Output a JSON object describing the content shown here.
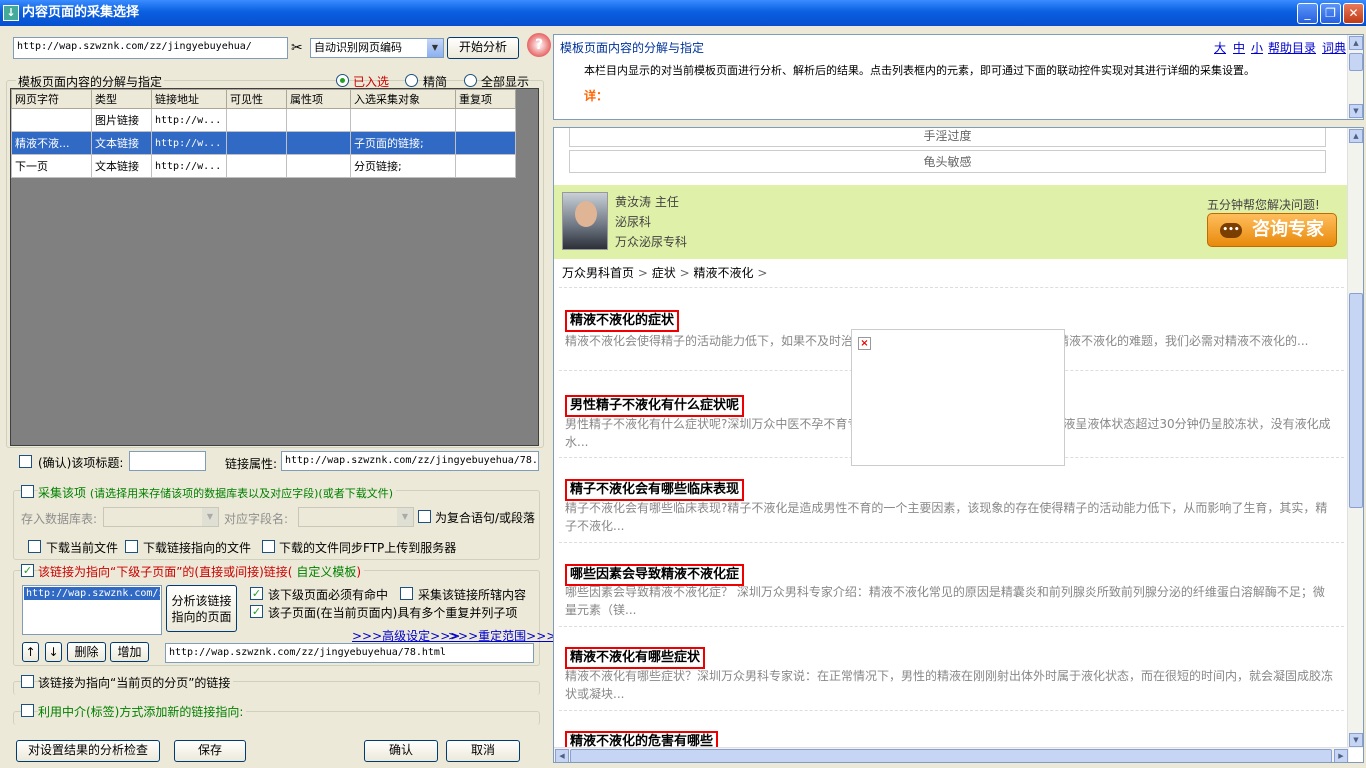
{
  "window": {
    "title": "内容页面的采集选择",
    "min": "_",
    "max": "❐",
    "close": "✕"
  },
  "top": {
    "url": "http://wap.szwznk.com/zz/jingyebuyehua/",
    "encoding": "自动识别网页编码",
    "start_button": "开始分析"
  },
  "group1": {
    "title": "模板页面内容的分解与指定",
    "radios": [
      "已入选",
      "精简",
      "全部显示"
    ]
  },
  "grid": {
    "headers": [
      "网页字符",
      "类型",
      "链接地址",
      "可见性",
      "属性项",
      "入选采集对象",
      "重复项"
    ],
    "rows": [
      [
        "",
        "图片链接",
        "http://w...",
        "",
        "",
        "",
        ""
      ],
      [
        "精液不液...",
        "文本链接",
        "http://w...",
        "",
        "",
        "子页面的链接;",
        ""
      ],
      [
        "下一页",
        "文本链接",
        "http://w...",
        "",
        "",
        "分页链接;",
        ""
      ]
    ]
  },
  "confirm": {
    "label": "(确认)该项标题:",
    "attr_label": "链接属性:",
    "attr_value": "http://wap.szwznk.com/zz/jingyebuyehua/78."
  },
  "collect": {
    "title": "采集该项",
    "hint": "(请选择用来存储该项的数据库表以及对应字段)(或者下载文件)",
    "db_label": "存入数据库表:",
    "field_label": "对应字段名:",
    "compound_label": "为复合语句/或段落",
    "dl_current": "下载当前文件",
    "dl_link": "下载链接指向的文件",
    "dl_ftp": "下载的文件同步FTP上传到服务器"
  },
  "sublink": {
    "title": "该链接为指向“下级子页面”的(直接或间接)链接(",
    "title_custom": "自定义模板",
    "title_end": ")",
    "list_item": "http://wap.szwznk.com/z",
    "analyze_button_l1": "分析该链接",
    "analyze_button_l2": "指向的页面",
    "must_hit": "该下级页面必须有命中",
    "collect_region": "采集该链接所辖内容",
    "multi_repeat": "该子页面(在当前页面内)具有多个重复并列子项",
    "advanced": ">>>高级设定>>>",
    "redefine": ">>>重定范围>>>",
    "up": "↑",
    "down": "↓",
    "delete": "删除",
    "add": "增加",
    "url_value": "http://wap.szwznk.com/zz/jingyebuyehua/78.html"
  },
  "paging": {
    "label": "该链接为指向“当前页的分页”的链接"
  },
  "intermediary": {
    "label": "利用中介(标签)方式添加新的链接指向:"
  },
  "bottom": {
    "check": "对设置结果的分析检查",
    "save": "保存",
    "ok": "确认",
    "cancel": "取消"
  },
  "help": {
    "title": "模板页面内容的分解与指定",
    "links": [
      "大",
      "中",
      "小",
      "帮助目录",
      "词典"
    ],
    "line1": "本栏目内显示的对当前模板页面进行分析、解析后的结果。点击列表框内的元素，即可通过下面的联动控件实现对其进行详细的采集设置。",
    "detail": "详："
  },
  "page": {
    "box1": "手淫过度",
    "box2": "龟头敏感",
    "doctor_name": "黄汝涛  主任",
    "doctor_dept": "泌尿科",
    "doctor_hosp": "万众泌尿专科",
    "slogan": "五分钟帮您解决问题!",
    "consult": "咨询专家",
    "crumbs": [
      "万众男科首页",
      ">",
      "症状",
      ">",
      "精液不液化",
      ">"
    ],
    "articles": [
      {
        "title": "精液不液化的症状",
        "text": "精液不液化会使得精子的活动能力低下，如果不及时治疗，可能会导致不育症。想要及时解决精液不液化的难题，我们必需对精液不液化的..."
      },
      {
        "title": "男性精子不液化有什么症状呢",
        "text": "男性精子不液化有什么症状呢?深圳万众中医不孕不育专家介绍：精液不液化是指正常射出的精液呈液体状态超过30分钟仍呈胶冻状，没有液化成水..."
      },
      {
        "title": "精子不液化会有哪些临床表现",
        "text": "精子不液化会有哪些临床表现?精子不液化是造成男性不育的一个主要因素，该现象的存在使得精子的活动能力低下，从而影响了生育，其实，精子不液化..."
      },
      {
        "title": "哪些因素会导致精液不液化症",
        "text": "哪些因素会导致精液不液化症？ 深圳万众男科专家介绍：精液不液化常见的原因是精囊炎和前列腺炎所致前列腺分泌的纤维蛋白溶解酶不足；微量元素（镁..."
      },
      {
        "title": "精液不液化有哪些症状",
        "text": "精液不液化有哪些症状？深圳万众男科专家说：在正常情况下，男性的精液在刚刚射出体外时属于液化状态，而在很短的时间内，就会凝固成胶冻状或凝块..."
      },
      {
        "title": "精液不液化的危害有哪些",
        "text": ""
      }
    ],
    "broken_img": "×"
  }
}
